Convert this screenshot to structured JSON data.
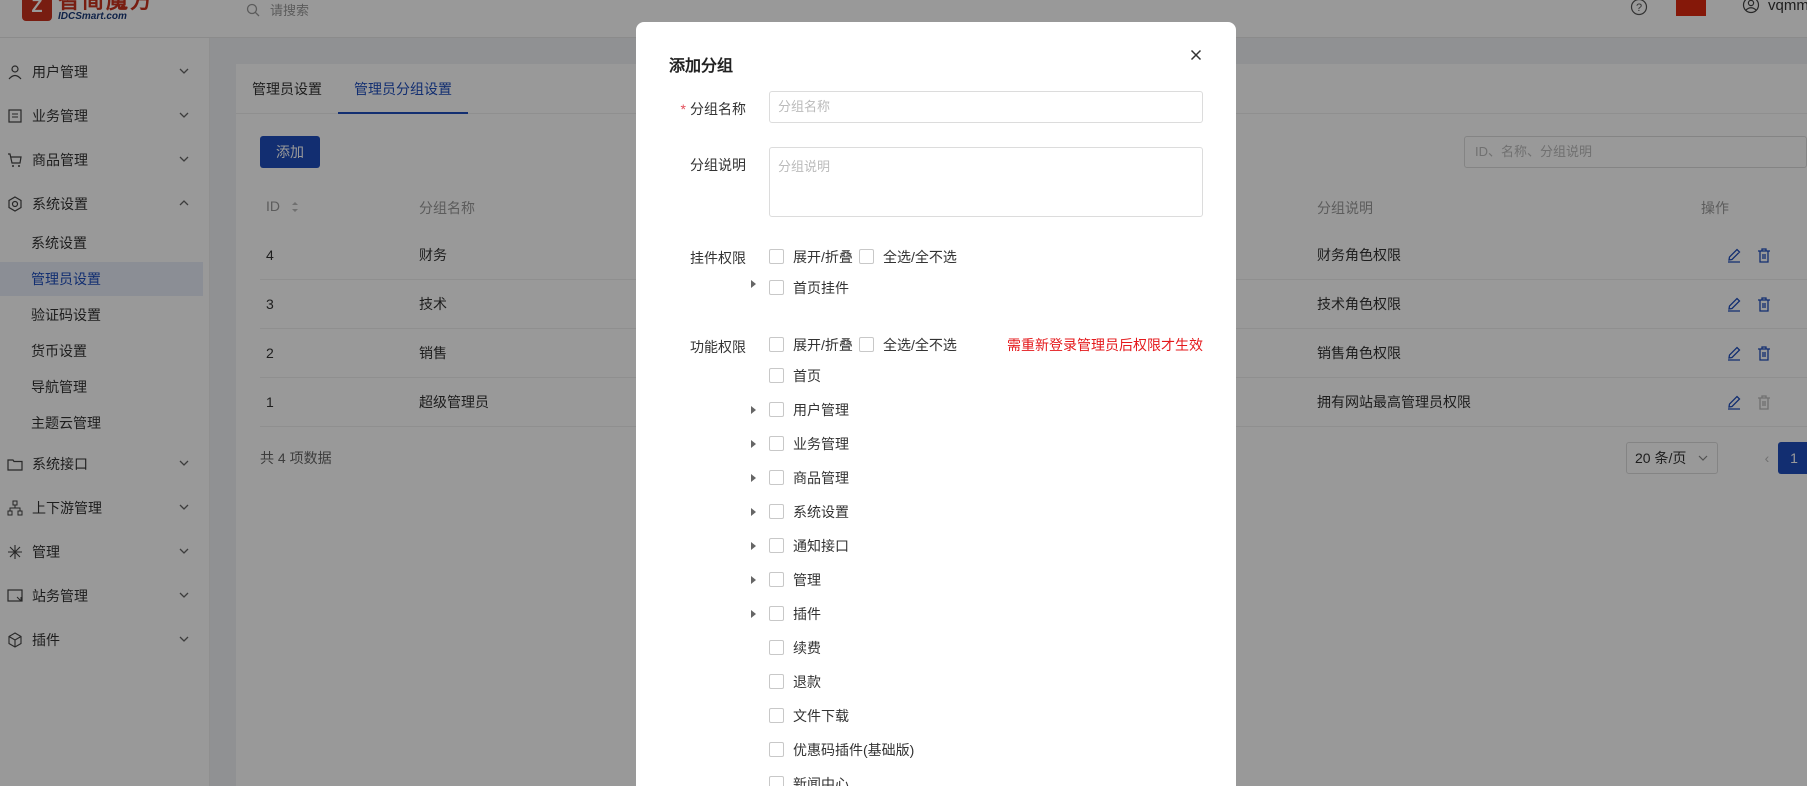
{
  "topbar": {
    "logo_cn": "智简魔方",
    "logo_en": "IDCSmart.com",
    "logo_mark": "Z",
    "search_placeholder": "请搜索",
    "user_name": "vqmm"
  },
  "sidebar": {
    "items": [
      {
        "label": "用户管理",
        "icon": "user-icon"
      },
      {
        "label": "业务管理",
        "icon": "document-icon"
      },
      {
        "label": "商品管理",
        "icon": "cart-icon"
      },
      {
        "label": "系统设置",
        "icon": "gear-icon"
      },
      {
        "label": "系统接口",
        "icon": "folder-icon"
      },
      {
        "label": "上下游管理",
        "icon": "hierarchy-icon"
      },
      {
        "label": "管理",
        "icon": "sparkle-icon"
      },
      {
        "label": "站务管理",
        "icon": "site-icon"
      },
      {
        "label": "插件",
        "icon": "cube-icon"
      }
    ],
    "sub_items": [
      "系统设置",
      "管理员设置",
      "验证码设置",
      "货币设置",
      "导航管理",
      "主题云管理"
    ]
  },
  "tabs": [
    "管理员设置",
    "管理员分组设置"
  ],
  "toolbar": {
    "add_label": "添加",
    "search_placeholder": "ID、名称、分组说明"
  },
  "table": {
    "headers": {
      "id": "ID",
      "name": "分组名称",
      "desc": "分组说明",
      "ops": "操作"
    },
    "rows": [
      {
        "id": "4",
        "name": "财务",
        "desc": "财务角色权限"
      },
      {
        "id": "3",
        "name": "技术",
        "desc": "技术角色权限"
      },
      {
        "id": "2",
        "name": "销售",
        "desc": "销售角色权限"
      },
      {
        "id": "1",
        "name": "超级管理员",
        "desc": "拥有网站最高管理员权限"
      }
    ]
  },
  "pagination": {
    "total": "共 4 项数据",
    "page_size": "20 条/页",
    "prev": "‹",
    "current": "1"
  },
  "modal": {
    "title": "添加分组",
    "close": "×",
    "name_label": "分组名称",
    "required_mark": "*",
    "name_placeholder": "分组名称",
    "desc_label": "分组说明",
    "desc_placeholder": "分组说明",
    "plugin_label": "挂件权限",
    "expand_collapse": "展开/折叠",
    "select_all": "全选/全不选",
    "plugin_items": [
      "首页挂件"
    ],
    "func_label": "功能权限",
    "warning": "需重新登录管理员后权限才生效",
    "func_items": [
      {
        "label": "首页",
        "expandable": false
      },
      {
        "label": "用户管理",
        "expandable": true
      },
      {
        "label": "业务管理",
        "expandable": true
      },
      {
        "label": "商品管理",
        "expandable": true
      },
      {
        "label": "系统设置",
        "expandable": true
      },
      {
        "label": "通知接口",
        "expandable": true
      },
      {
        "label": "管理",
        "expandable": true
      },
      {
        "label": "插件",
        "expandable": true
      },
      {
        "label": "续费",
        "expandable": false
      },
      {
        "label": "退款",
        "expandable": false
      },
      {
        "label": "文件下载",
        "expandable": false
      },
      {
        "label": "优惠码插件(基础版)",
        "expandable": false
      },
      {
        "label": "新闻中心",
        "expandable": false
      }
    ]
  },
  "colors": {
    "primary": "#1f4ebc",
    "warning": "#e4181b",
    "required": "#e34d59",
    "logo": "#c8311d"
  }
}
